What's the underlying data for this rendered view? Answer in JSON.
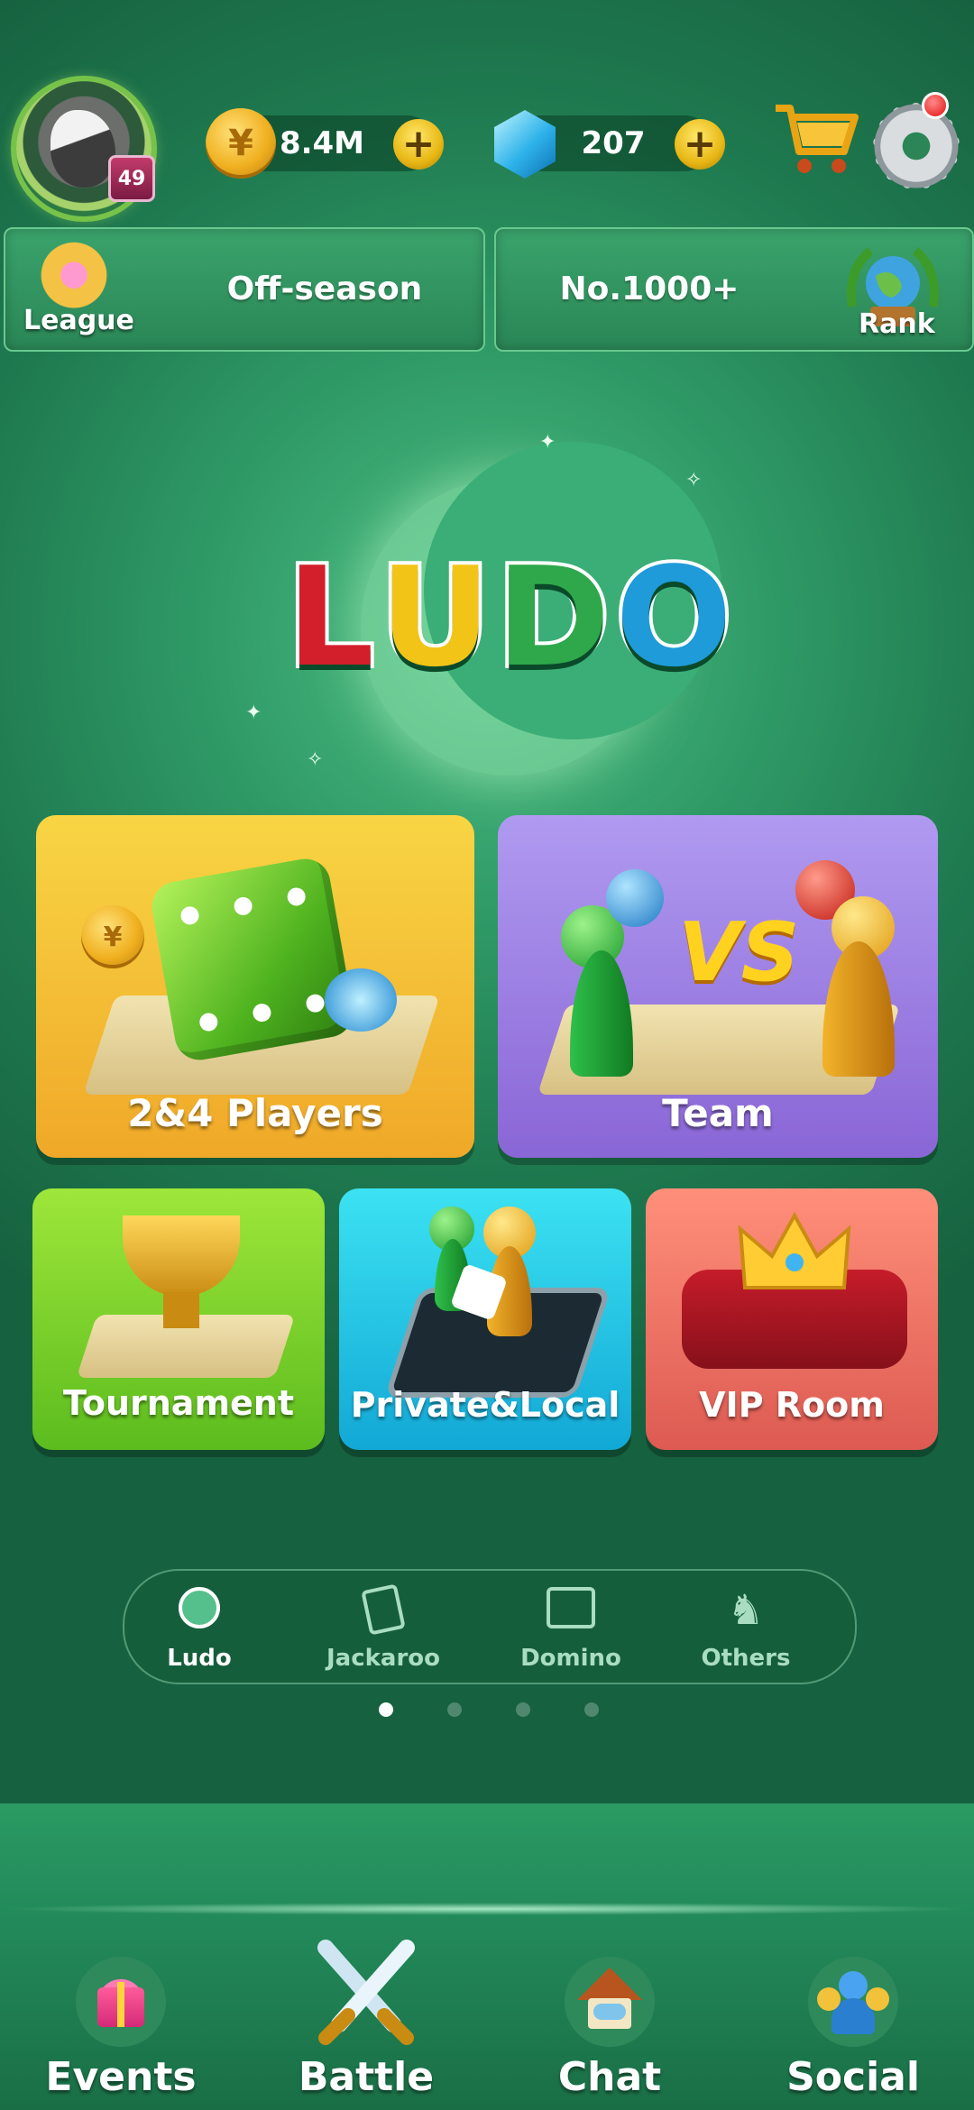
{
  "header": {
    "player_level": "49",
    "coins": "8.4M",
    "gems": "207"
  },
  "panels": {
    "league_status": "Off-season",
    "league_label": "League",
    "rank_value": "No.1000+",
    "rank_label": "Rank"
  },
  "logo": {
    "letters": [
      "L",
      "U",
      "D",
      "O"
    ],
    "colors": [
      "#d21f2b",
      "#f2c418",
      "#2ea84a",
      "#1e9bd8"
    ]
  },
  "modes": {
    "players": "2&4 Players",
    "team": "Team",
    "team_vs": "VS",
    "tournament": "Tournament",
    "private_local": "Private&Local",
    "vip_room": "VIP Room"
  },
  "categories": [
    {
      "label": "Ludo",
      "icon": "ludo-piece-icon",
      "active": true
    },
    {
      "label": "Jackaroo",
      "icon": "jackaroo-card-icon",
      "active": false
    },
    {
      "label": "Domino",
      "icon": "domino-icon",
      "active": false
    },
    {
      "label": "Others",
      "icon": "horse-icon",
      "active": false
    }
  ],
  "pager": {
    "count": 4,
    "active": 0
  },
  "nav": [
    {
      "label": "Events",
      "icon": "gift-icon"
    },
    {
      "label": "Battle",
      "icon": "crossed-swords-icon"
    },
    {
      "label": "Chat",
      "icon": "chat-house-icon"
    },
    {
      "label": "Social",
      "icon": "people-icon"
    }
  ],
  "colors": {
    "background": "#2f9a66",
    "card_players": "#f4b52a",
    "card_team": "#9c7be0",
    "card_tournament": "#7cd12c",
    "card_private": "#1fc3e0",
    "card_vip": "#ef7a6a",
    "category_active": "#ffffff",
    "category_inactive": "#a9ddc1"
  }
}
